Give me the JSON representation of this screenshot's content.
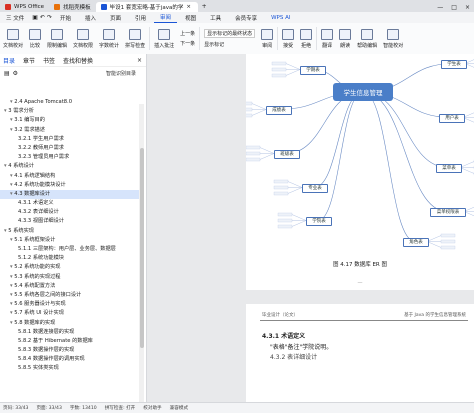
{
  "tabs": [
    {
      "label": "WPS Office",
      "color": "#d93025"
    },
    {
      "label": "找稻壳模板",
      "color": "#e8710a"
    },
    {
      "label": "毕设1 套宽宏略-基于java的学",
      "color": "#1a55d6"
    }
  ],
  "menu": [
    "三 文件",
    "开始",
    "插入",
    "页面",
    "引用",
    "审阅",
    "视图",
    "工具",
    "会员专享",
    "WPS AI"
  ],
  "menu_active_index": 5,
  "toolbar": {
    "doc_compare": "文档校对",
    "compare": "比较",
    "restrict_edit": "限制编辑",
    "document_rights": "文档权限",
    "word_count": "字数统计",
    "proof_check": "拼写检查",
    "insert_comment": "插入批注",
    "prev": "上一条",
    "next": "下一条",
    "show_markup": "显示标记的最终状态",
    "show_marks": "显示标记",
    "track": "审阅",
    "accept": "接受",
    "reject": "拒绝",
    "translate": "翻译",
    "read_aloud": "朗读",
    "help": "帮助编辑",
    "smart_check": "智能校对"
  },
  "nav": {
    "tabs": [
      "目录",
      "章节",
      "书签",
      "查找和替换"
    ],
    "active_tab": 0,
    "smart_label": "智能识别目录",
    "items": [
      {
        "text": "2.4 Apache Tomcat8.0",
        "level": 2
      },
      {
        "text": "3 需求分析",
        "level": 1
      },
      {
        "text": "3.1 编写目的",
        "level": 2
      },
      {
        "text": "3.2 需求描述",
        "level": 2
      },
      {
        "text": "3.2.1 学生用户需求",
        "level": 3
      },
      {
        "text": "3.2.2 教师用户需求",
        "level": 3
      },
      {
        "text": "3.2.3 管理员用户需求",
        "level": 3
      },
      {
        "text": "4 系统设计",
        "level": 1
      },
      {
        "text": "4.1 系统逻辑结构",
        "level": 2
      },
      {
        "text": "4.2 系统功能模块设计",
        "level": 2
      },
      {
        "text": "4.3 数据库设计",
        "level": 2
      },
      {
        "text": "4.3.1 术语定义",
        "level": 3
      },
      {
        "text": "4.3.2 表详细设计",
        "level": 3
      },
      {
        "text": "4.3.3 视图详细设计",
        "level": 3
      },
      {
        "text": "5 系统实现",
        "level": 1
      },
      {
        "text": "5.1 系统框架设计",
        "level": 2
      },
      {
        "text": "5.1.1 三层架构：用户层、业务层、数据层",
        "level": 3
      },
      {
        "text": "5.1.2 系统功能模块",
        "level": 3
      },
      {
        "text": "5.2 系统功能的实现",
        "level": 2
      },
      {
        "text": "5.3 系统的实现过程",
        "level": 2
      },
      {
        "text": "5.4 系统配置方法",
        "level": 2
      },
      {
        "text": "5.5 系统各层之间的接口设计",
        "level": 2
      },
      {
        "text": "5.6 服务器设计与实现",
        "level": 2
      },
      {
        "text": "5.7 系统 UI 设计实现",
        "level": 2
      },
      {
        "text": "5.8 数据库的实现",
        "level": 2
      },
      {
        "text": "5.8.1 数据连接层的实现",
        "level": 3
      },
      {
        "text": "5.8.2 基于 Hibernate 的数据库",
        "level": 3
      },
      {
        "text": "5.8.3 数据操作层的实现",
        "level": 3
      },
      {
        "text": "5.8.4 数据操作层的调用实现",
        "level": 3
      },
      {
        "text": "5.8.5 实体类实现",
        "level": 3
      }
    ],
    "selected_index": 10
  },
  "diagram": {
    "center": "学生信息管理",
    "tables": [
      "学期表",
      "成绩表",
      "班级表",
      "专业表",
      "学院表",
      "学生表",
      "用户表",
      "菜单表",
      "菜单权限表",
      "角色表"
    ],
    "caption": "图 4.17 数据库 ER 图",
    "page_num": "—"
  },
  "page2": {
    "header_left": "毕业设计（论文）",
    "header_right": "基于 Java 的学生信息管理系统",
    "section": "4.3.1 术语定义",
    "para": "\"表格\"备注\"学院说明。",
    "para2": "4.3.2 表详细设计"
  },
  "status": {
    "page": "页码: 33/43",
    "pages": "页面: 33/43",
    "words": "字数: 13410",
    "spell": "拼写检查: 打开",
    "proof": "校对助手",
    "mode": "兼容模式"
  }
}
